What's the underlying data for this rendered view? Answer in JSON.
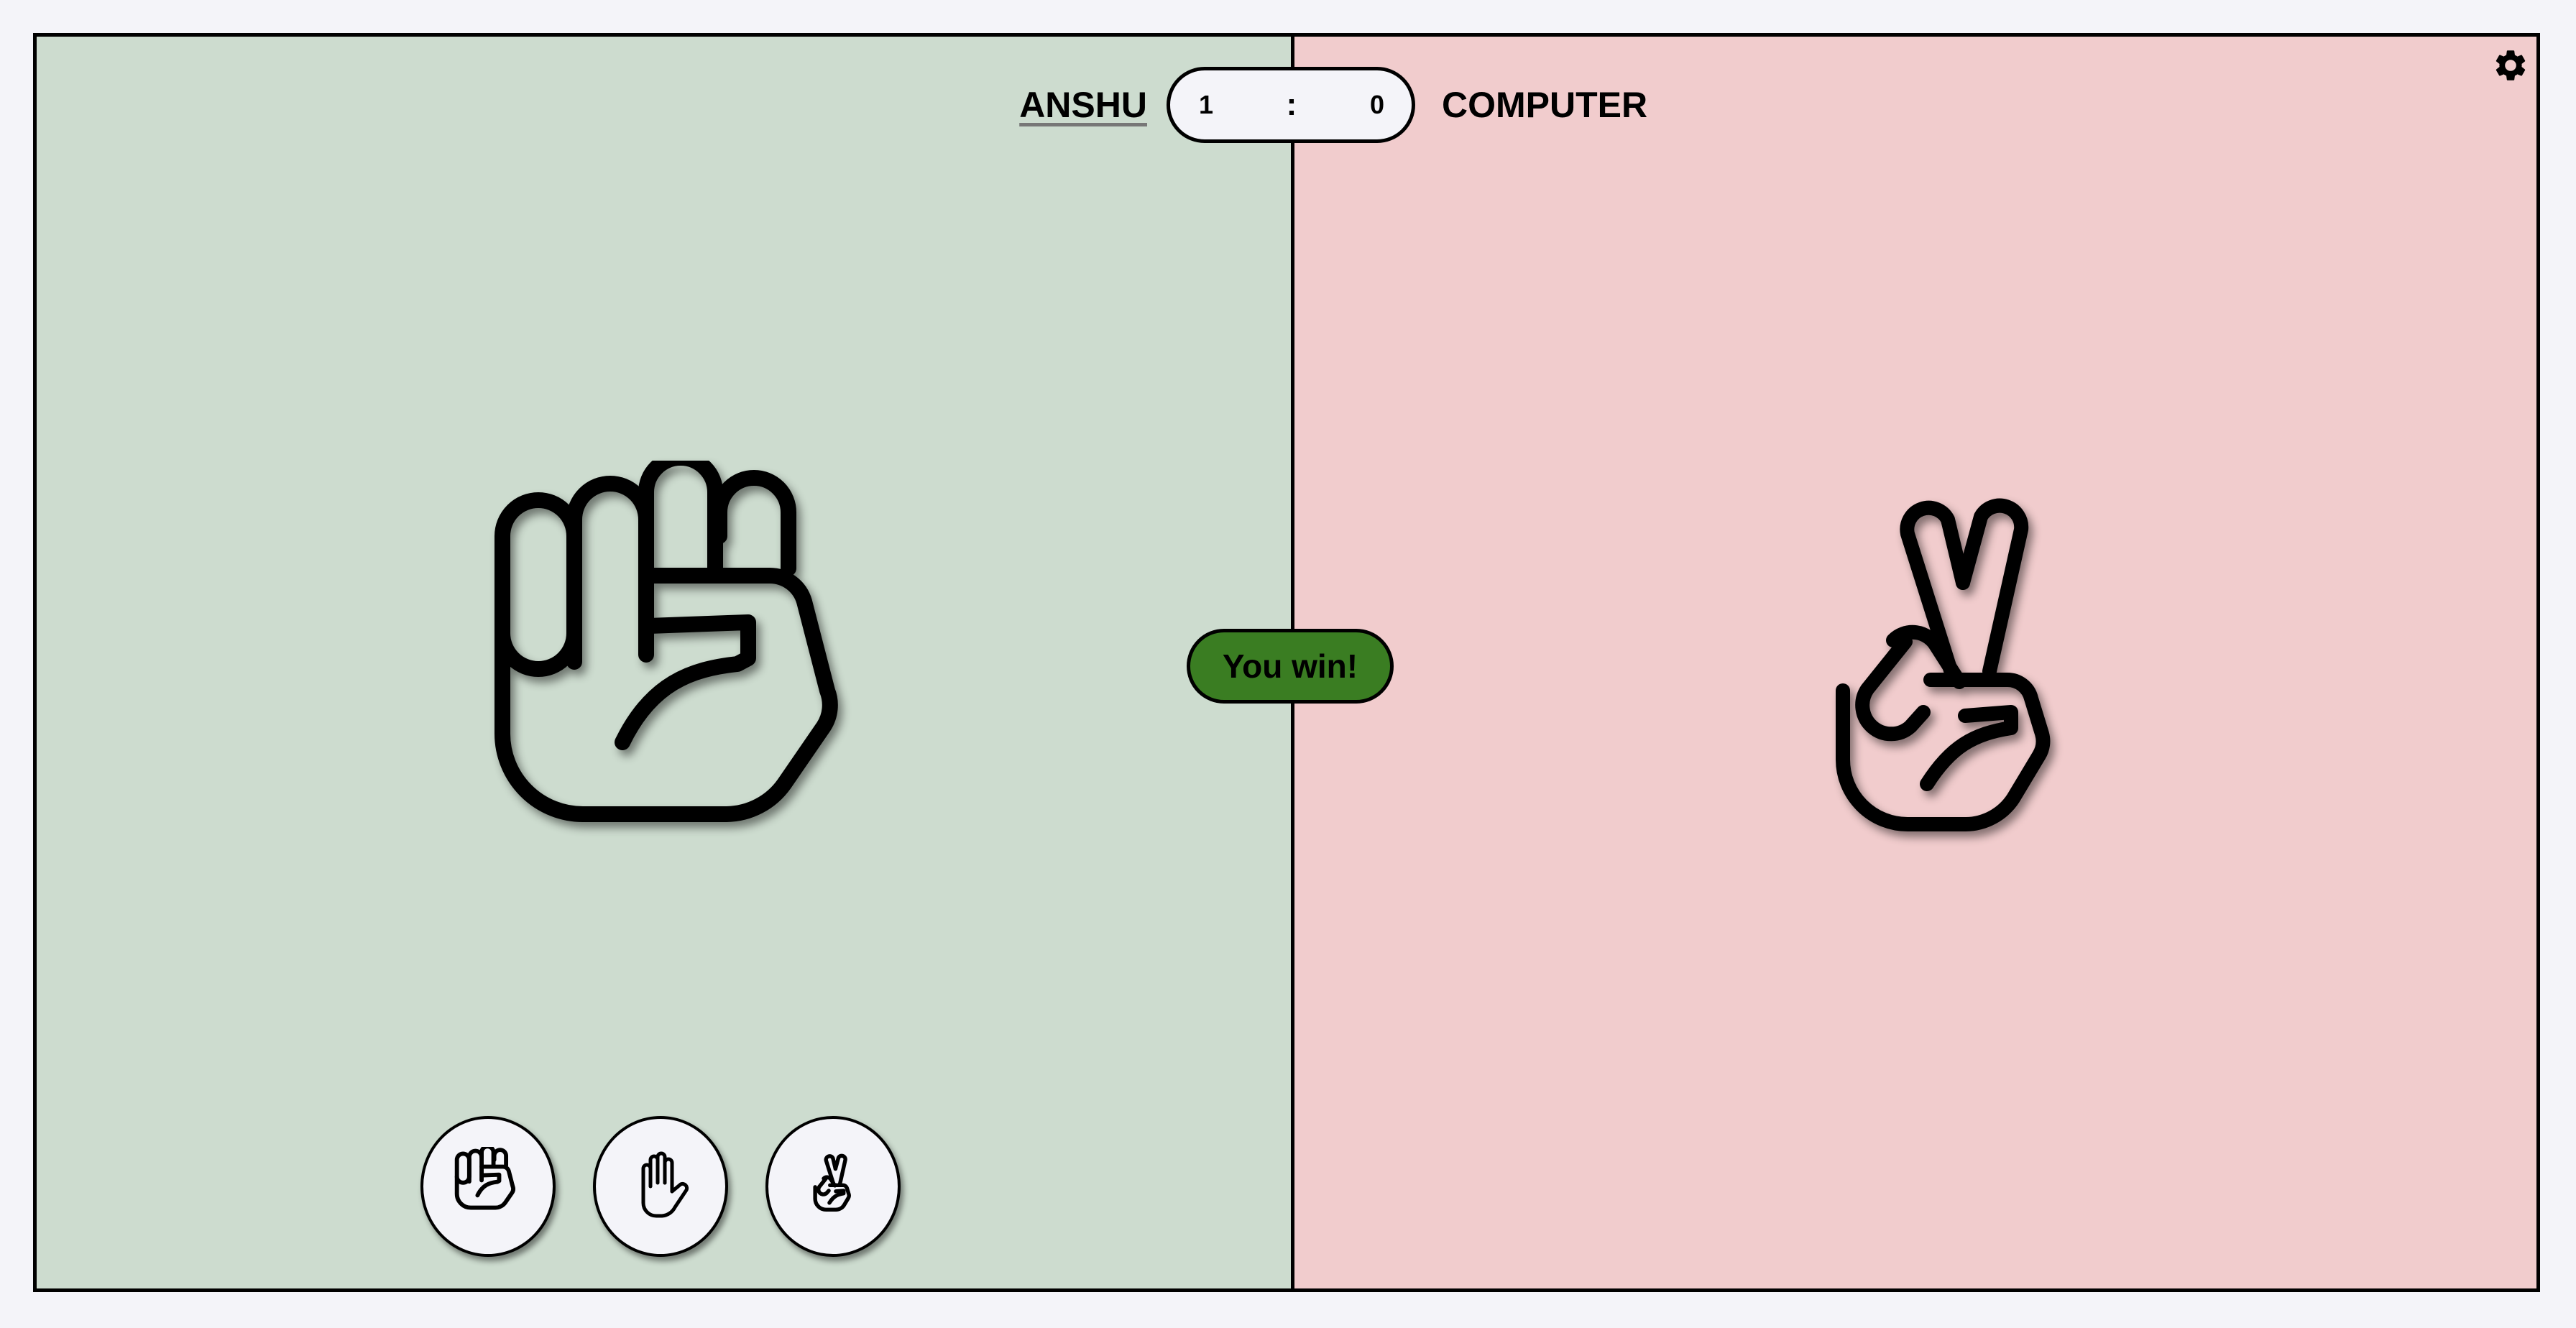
{
  "players": {
    "you": "ANSHU",
    "computer": "COMPUTER"
  },
  "score": {
    "you": "1",
    "separator": ":",
    "computer": "0"
  },
  "result": "You win!",
  "choices": {
    "player": "rock",
    "computer": "scissors"
  },
  "controls": [
    {
      "icon": "rock-icon"
    },
    {
      "icon": "paper-icon"
    },
    {
      "icon": "scissors-icon"
    }
  ],
  "colors": {
    "player_side": "#cddccf",
    "computer_side": "#f1cccd",
    "win_badge": "#3a7d22",
    "page_bg": "#f4f4f9"
  }
}
